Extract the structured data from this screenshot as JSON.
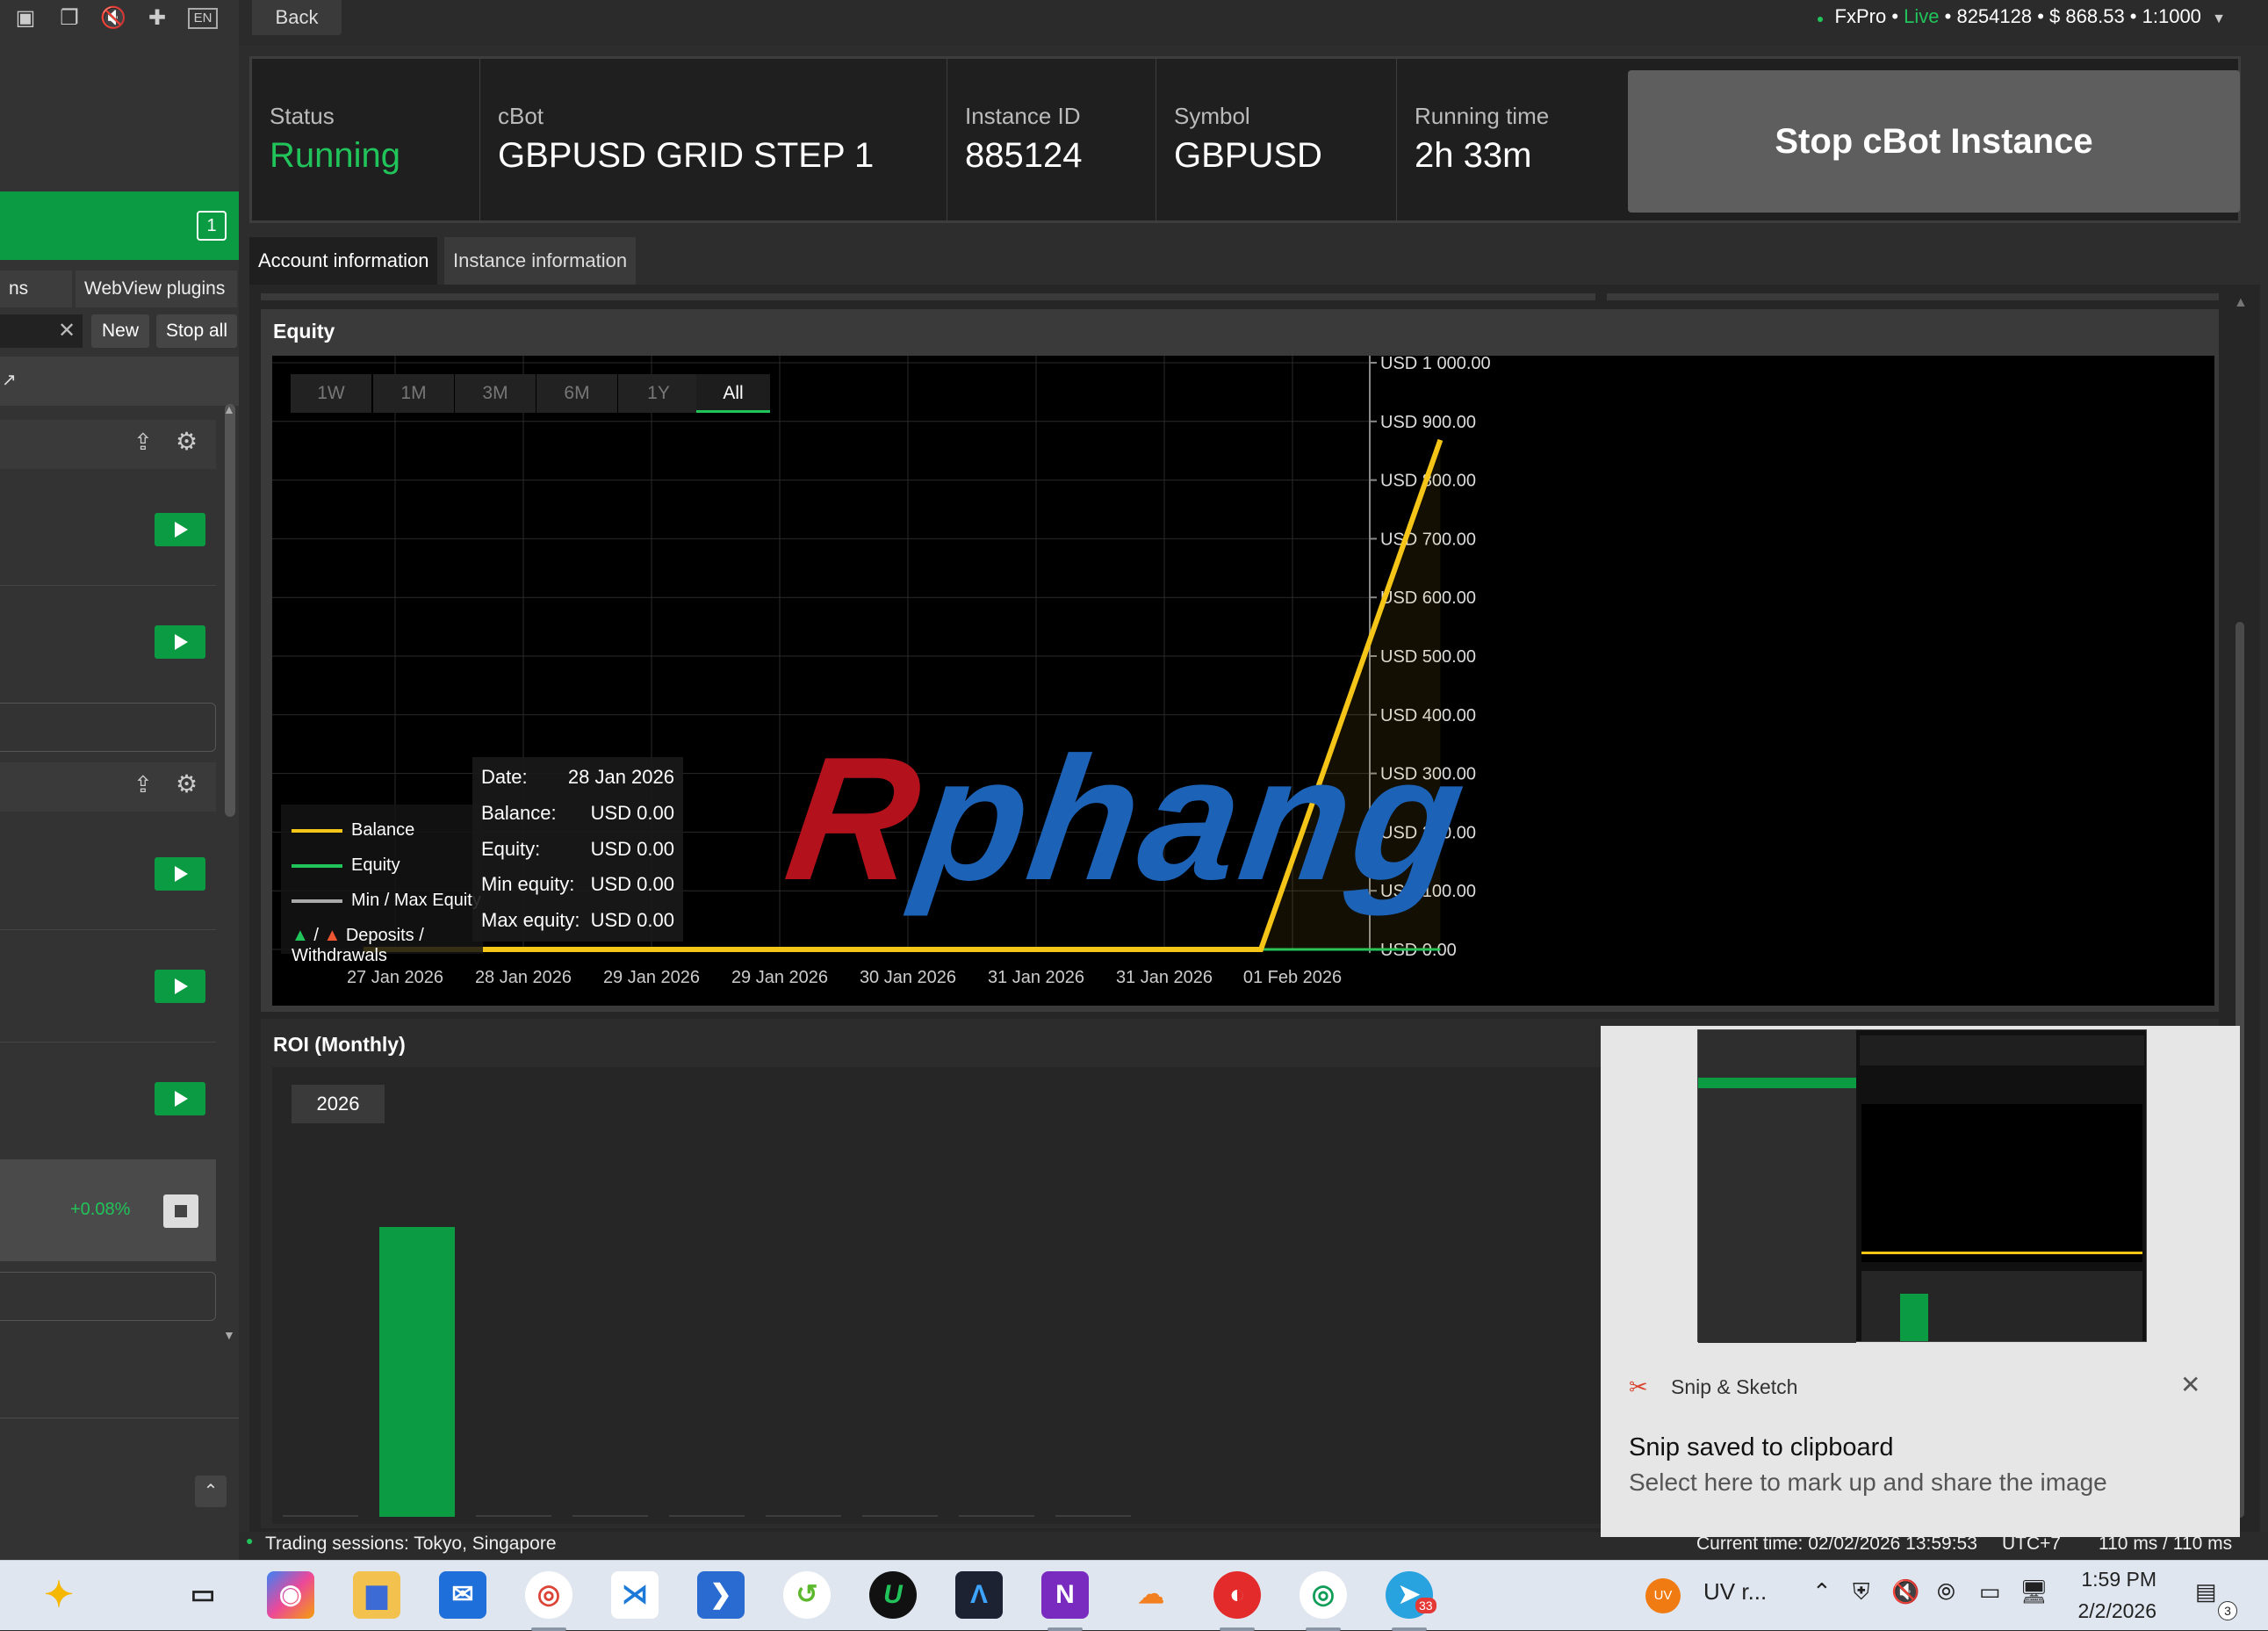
{
  "header": {
    "back_label": "Back",
    "broker": "FxPro",
    "mode": "Live",
    "account_id": "8254128",
    "balance": "$ 868.53",
    "leverage": "1:1000",
    "account_line": "FxPro • Live • 8254128 • $ 868.53 • 1:1000"
  },
  "sidebar": {
    "badge_count": "1",
    "tabs": [
      "ns",
      "WebView plugins"
    ],
    "buttons": [
      "New",
      "Stop all"
    ],
    "instance_pnl": "+0.08%",
    "lang": "EN"
  },
  "instance": {
    "status_label": "Status",
    "status_value": "Running",
    "cbot_label": "cBot",
    "cbot_value": "GBPUSD GRID STEP 1",
    "id_label": "Instance ID",
    "id_value": "885124",
    "symbol_label": "Symbol",
    "symbol_value": "GBPUSD",
    "runtime_label": "Running time",
    "runtime_value": "2h 33m",
    "stop_label": "Stop cBot Instance"
  },
  "tabs": [
    "Account information",
    "Instance information"
  ],
  "equity": {
    "title": "Equity",
    "ranges": [
      "1W",
      "1M",
      "3M",
      "6M",
      "1Y",
      "All"
    ],
    "active_range": "All",
    "legend": [
      "Balance",
      "Equity",
      "Min / Max Equity",
      "Deposits / Withdrawals"
    ],
    "legend_sep": "/",
    "tooltip": {
      "date_label": "Date:",
      "date": "28 Jan 2026",
      "balance_label": "Balance:",
      "balance": "USD 0.00",
      "equity_label": "Equity:",
      "equity": "USD 0.00",
      "min_label": "Min equity:",
      "min": "USD 0.00",
      "max_label": "Max equity:",
      "max": "USD 0.00"
    },
    "watermark": "Rphang"
  },
  "chart_data": {
    "type": "line",
    "title": "Equity",
    "x": [
      "27 Jan 2026",
      "28 Jan 2026",
      "29 Jan 2026",
      "29 Jan 2026",
      "30 Jan 2026",
      "31 Jan 2026",
      "31 Jan 2026",
      "01 Feb 2026"
    ],
    "y_ticks": [
      "USD 1 000.00",
      "USD 900.00",
      "USD 800.00",
      "USD 700.00",
      "USD 600.00",
      "USD 500.00",
      "USD 400.00",
      "USD 300.00",
      "USD 200.00",
      "USD 100.00",
      "USD 0.00"
    ],
    "ylim": [
      0,
      1000
    ],
    "series": [
      {
        "name": "Balance",
        "color": "#f5c518",
        "points": [
          [
            0,
            0
          ],
          [
            7.0,
            0
          ],
          [
            8.4,
            868.53
          ]
        ]
      },
      {
        "name": "Equity",
        "color": "#21c45a",
        "points": [
          [
            0,
            0
          ],
          [
            8.4,
            0
          ]
        ]
      }
    ]
  },
  "roi": {
    "title": "ROI (Monthly)",
    "year": "2026"
  },
  "roi_chart_data": {
    "type": "bar",
    "categories": [
      "",
      "",
      "",
      "",
      "",
      "",
      "",
      "",
      ""
    ],
    "values": [
      0,
      100,
      0,
      0,
      0,
      0,
      0,
      0,
      0
    ]
  },
  "status": {
    "sessions": "Trading sessions: Tokyo, Singapore",
    "current_time": "Current time: 02/02/2026 13:59:53",
    "tz": "UTC+7",
    "latency": "110 ms / 110 ms"
  },
  "toast": {
    "app": "Snip & Sketch",
    "title": "Snip saved to clipboard",
    "body": "Select here to mark up and share the image"
  },
  "taskbar": {
    "tray_app": "UV r...",
    "tray_badge": "UV",
    "time": "1:59 PM",
    "date": "2/2/2026",
    "telegram_badge": "33",
    "notif_count": "3"
  },
  "colors": {
    "accent_green": "#0b9b43",
    "balance_line": "#f5c518",
    "running": "#21c45a"
  }
}
